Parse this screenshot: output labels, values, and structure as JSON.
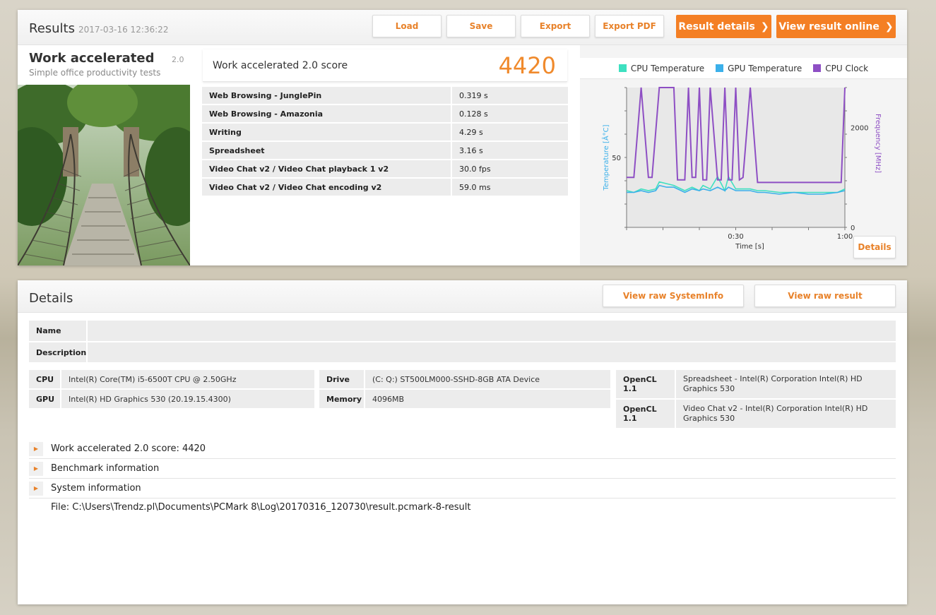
{
  "results": {
    "title": "Results",
    "timestamp": "2017-03-16 12:36:22",
    "buttons": {
      "load": "Load",
      "save": "Save",
      "export": "Export",
      "export_pdf": "Export PDF",
      "result_details": "Result details",
      "view_online": "View result online"
    },
    "benchmark": {
      "name": "Work accelerated",
      "version": "2.0",
      "description": "Simple office productivity tests"
    },
    "score": {
      "label": "Work accelerated 2.0 score",
      "value": "4420"
    },
    "subscores": [
      {
        "name": "Web Browsing - JunglePin",
        "value": "0.319 s"
      },
      {
        "name": "Web Browsing - Amazonia",
        "value": "0.128 s"
      },
      {
        "name": "Writing",
        "value": "4.29 s"
      },
      {
        "name": "Spreadsheet",
        "value": "3.16 s"
      },
      {
        "name": "Video Chat v2 / Video Chat playback 1 v2",
        "value": "30.0 fps"
      },
      {
        "name": "Video Chat v2 / Video Chat encoding v2",
        "value": "59.0 ms"
      }
    ],
    "chart_details_label": "Details"
  },
  "chart_data": {
    "type": "line",
    "legend": [
      "CPU Temperature",
      "GPU Temperature",
      "CPU Clock"
    ],
    "colors": {
      "cpu_temp": "#3ee0c0",
      "gpu_temp": "#3bb0ea",
      "cpu_clock": "#8e4fc4"
    },
    "xlabel": "Time [s]",
    "ylabel_left": "Temperature [Â°C]",
    "ylabel_right": "Frequency [MHz]",
    "xlim": [
      0,
      60
    ],
    "ylim_left": [
      30,
      70
    ],
    "ylim_right": [
      0,
      2800
    ],
    "xticks": [
      {
        "v": 30,
        "label": "0:30"
      },
      {
        "v": 60,
        "label": "1:00"
      }
    ],
    "yticks_left": [
      {
        "v": 50,
        "label": "50"
      }
    ],
    "yticks_right": [
      {
        "v": 2000,
        "label": "2000"
      },
      {
        "v": 0,
        "label": "0"
      }
    ],
    "series": [
      {
        "name": "CPU Temperature",
        "x": [
          0,
          2,
          4,
          6,
          8,
          9,
          11,
          13,
          15,
          16,
          18,
          20,
          21,
          23,
          25,
          27,
          28,
          30,
          32,
          34,
          36,
          38,
          42,
          46,
          50,
          54,
          58,
          60
        ],
        "values": [
          40.5,
          40,
          41,
          40.5,
          41,
          43,
          42.5,
          42,
          41,
          40.5,
          41.5,
          40.5,
          42,
          41,
          44.5,
          40.5,
          44.5,
          41,
          41,
          41,
          40.5,
          40.5,
          40,
          40,
          40,
          40,
          40,
          41
        ]
      },
      {
        "name": "GPU Temperature",
        "x": [
          0,
          2,
          4,
          6,
          8,
          9,
          11,
          13,
          15,
          16,
          18,
          20,
          21,
          23,
          25,
          27,
          28,
          30,
          32,
          34,
          36,
          38,
          42,
          46,
          50,
          54,
          58,
          60
        ],
        "values": [
          40,
          40,
          40.5,
          40,
          40.5,
          42,
          41.5,
          41.5,
          40.5,
          40,
          41,
          40.5,
          41,
          40.5,
          41.5,
          40.5,
          41.5,
          40.5,
          40.5,
          40.5,
          40,
          40,
          39.5,
          40,
          39.5,
          39.5,
          40,
          40.5
        ]
      },
      {
        "name": "CPU Clock",
        "x": [
          0,
          2,
          4,
          6,
          7,
          9,
          11,
          13,
          14,
          16,
          17,
          18,
          19,
          20,
          21,
          22,
          23,
          25,
          26,
          27,
          28,
          29,
          30,
          31,
          32,
          34,
          36,
          38,
          40,
          42,
          50,
          54,
          58,
          59,
          60
        ],
        "values": [
          1000,
          1000,
          2800,
          1000,
          1000,
          3000,
          2900,
          3000,
          950,
          950,
          3000,
          1000,
          1000,
          3000,
          950,
          950,
          3000,
          950,
          950,
          3000,
          950,
          950,
          3000,
          950,
          1000,
          3000,
          900,
          900,
          900,
          900,
          900,
          900,
          900,
          900,
          2900
        ]
      }
    ]
  },
  "details": {
    "title": "Details",
    "buttons": {
      "raw_systeminfo": "View raw SystemInfo",
      "raw_result": "View raw result"
    },
    "name_label": "Name",
    "name_value": "",
    "description_label": "Description",
    "description_value": "",
    "cpu_label": "CPU",
    "cpu_value": "Intel(R) Core(TM) i5-6500T CPU @ 2.50GHz",
    "gpu_label": "GPU",
    "gpu_value": "Intel(R) HD Graphics 530 (20.19.15.4300)",
    "drive_label": "Drive",
    "drive_value": "(C: Q:) ST500LM000-SSHD-8GB ATA Device",
    "memory_label": "Memory",
    "memory_value": "4096MB",
    "opencl": [
      {
        "label": "OpenCL 1.1",
        "value": "Spreadsheet - Intel(R) Corporation Intel(R) HD Graphics 530"
      },
      {
        "label": "OpenCL 1.1",
        "value": "Video Chat v2 - Intel(R) Corporation Intel(R) HD Graphics 530"
      }
    ],
    "sections": [
      "Work accelerated 2.0 score: 4420",
      "Benchmark information",
      "System information"
    ],
    "file_path": "File: C:\\Users\\Trendz.pl\\Documents\\PCMark 8\\Log\\20170316_120730\\result.pcmark-8-result"
  }
}
